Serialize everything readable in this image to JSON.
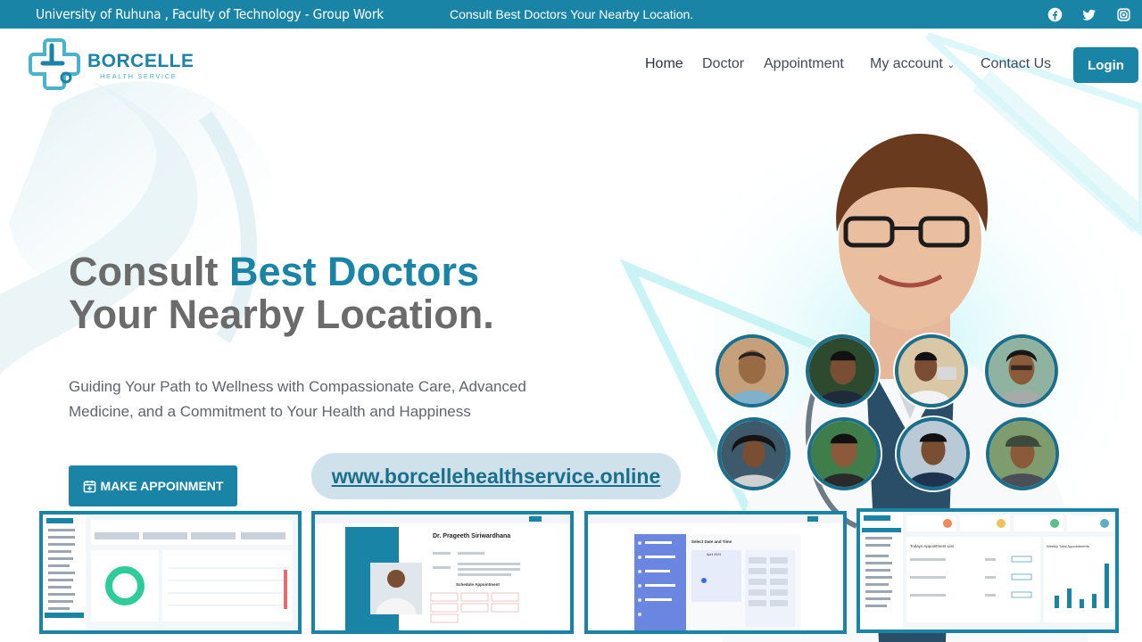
{
  "topbar": {
    "left_text": "University of Ruhuna , Faculty of Technology - Group Work",
    "center_text": "Consult Best Doctors Your Nearby Location.",
    "social": [
      "facebook-icon",
      "twitter-icon",
      "instagram-icon"
    ]
  },
  "logo": {
    "brand": "BORCELLE",
    "sub": "HEALTH SERVICE"
  },
  "nav": {
    "items": [
      "Home",
      "Doctor",
      "Appointment",
      "My account",
      "Contact Us"
    ],
    "login": "Login"
  },
  "hero": {
    "title_part1": "Consult ",
    "title_accent": "Best Doctors",
    "title_line2": "Your Nearby Location.",
    "description": "Guiding Your Path to Wellness with Compassionate Care, Advanced Medicine, and a Commitment to Your Health and Happiness",
    "cta": "MAKE APPOINMENT",
    "url": "www.borcellehealthservice.online"
  },
  "thumbnails": {
    "doctor_name": "Dr. Prageeth Siriwardhana",
    "schedule_label": "Schedule Appointment",
    "select_date_label": "Select Date and Time",
    "month_label": "April 2024",
    "today_label": "Todays Appointment List",
    "weekly_label": "Weekly Total Appointments"
  },
  "colors": {
    "primary": "#1a84a6",
    "dark": "#1a6f8d",
    "text": "#6b6b6b"
  }
}
